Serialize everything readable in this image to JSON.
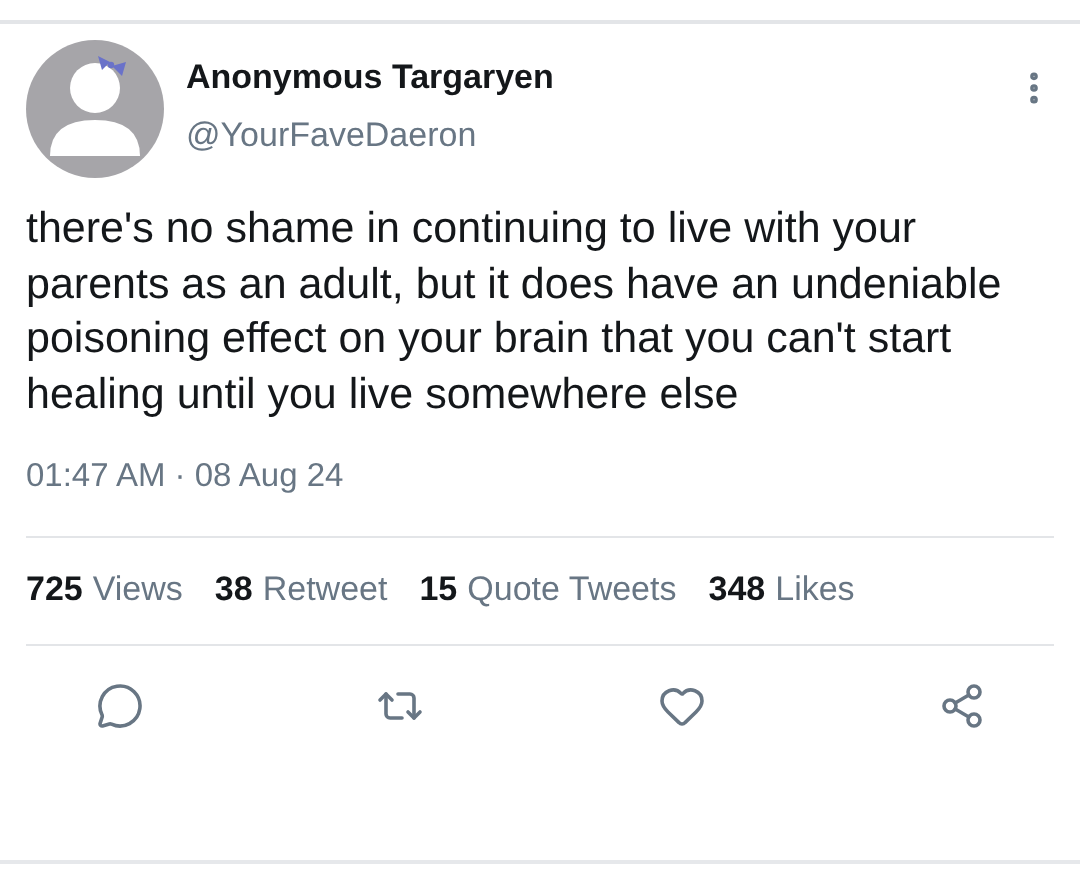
{
  "author": {
    "name": "Anonymous Targaryen",
    "handle": "@YourFaveDaeron"
  },
  "text": "there's no shame in continuing to live with your parents as an adult, but it does have an undeniable poisoning effect on your brain that you can't start healing until you live somewhere else",
  "timestamp": "01:47 AM · 08 Aug 24",
  "stats": [
    {
      "count": "725",
      "label": "Views"
    },
    {
      "count": "38",
      "label": "Retweet"
    },
    {
      "count": "15",
      "label": "Quote Tweets"
    },
    {
      "count": "348",
      "label": "Likes"
    }
  ],
  "actions": [
    {
      "kind": "reply"
    },
    {
      "kind": "retweet"
    },
    {
      "kind": "like"
    },
    {
      "kind": "share"
    }
  ]
}
